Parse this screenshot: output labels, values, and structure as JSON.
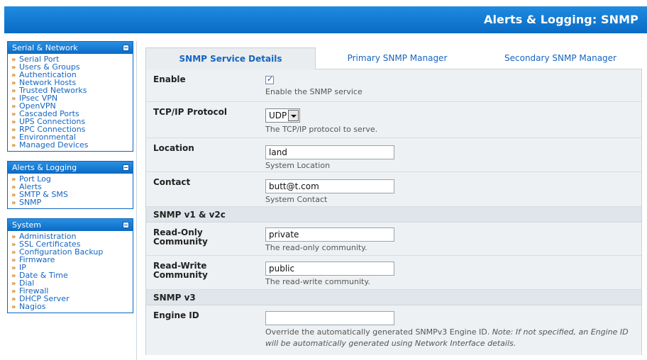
{
  "header": {
    "title": "Alerts & Logging: SNMP"
  },
  "sidebar": {
    "panels": [
      {
        "title": "Serial & Network",
        "items": [
          "Serial Port",
          "Users & Groups",
          "Authentication",
          "Network Hosts",
          "Trusted Networks",
          "IPsec VPN",
          "OpenVPN",
          "Cascaded Ports",
          "UPS Connections",
          "RPC Connections",
          "Environmental",
          "Managed Devices"
        ]
      },
      {
        "title": "Alerts & Logging",
        "items": [
          "Port Log",
          "Alerts",
          "SMTP & SMS",
          "SNMP"
        ]
      },
      {
        "title": "System",
        "items": [
          "Administration",
          "SSL Certificates",
          "Configuration Backup",
          "Firmware",
          "IP",
          "Date & Time",
          "Dial",
          "Firewall",
          "DHCP Server",
          "Nagios"
        ]
      }
    ],
    "arrow_glyph": "»"
  },
  "tabs": [
    "SNMP Service Details",
    "Primary SNMP Manager",
    "Secondary SNMP Manager"
  ],
  "form": {
    "enable": {
      "label": "Enable",
      "checked": true,
      "help": "Enable the SNMP service"
    },
    "protocol": {
      "label": "TCP/IP Protocol",
      "value": "UDP",
      "help": "The TCP/IP protocol to serve."
    },
    "location": {
      "label": "Location",
      "value": "land",
      "help": "System Location"
    },
    "contact": {
      "label": "Contact",
      "value": "butt@t.com",
      "help": "System Contact"
    },
    "section_v1": "SNMP v1 & v2c",
    "ro_community": {
      "label_line1": "Read-Only",
      "label_line2": "Community",
      "value": "private",
      "help": "The read-only community."
    },
    "rw_community": {
      "label_line1": "Read-Write",
      "label_line2": "Community",
      "value": "public",
      "help": "The read-write community."
    },
    "section_v3": "SNMP v3",
    "engine_id": {
      "label": "Engine ID",
      "value": "",
      "help_normal": "Override the automatically generated SNMPv3 Engine ID.",
      "help_note": "Note: If not specified, an Engine ID will be automatically generated using Network Interface details."
    }
  },
  "colors": {
    "header_blue": "#0a6bc4",
    "link_blue": "#1565c0",
    "arrow_orange": "#d07a16"
  }
}
